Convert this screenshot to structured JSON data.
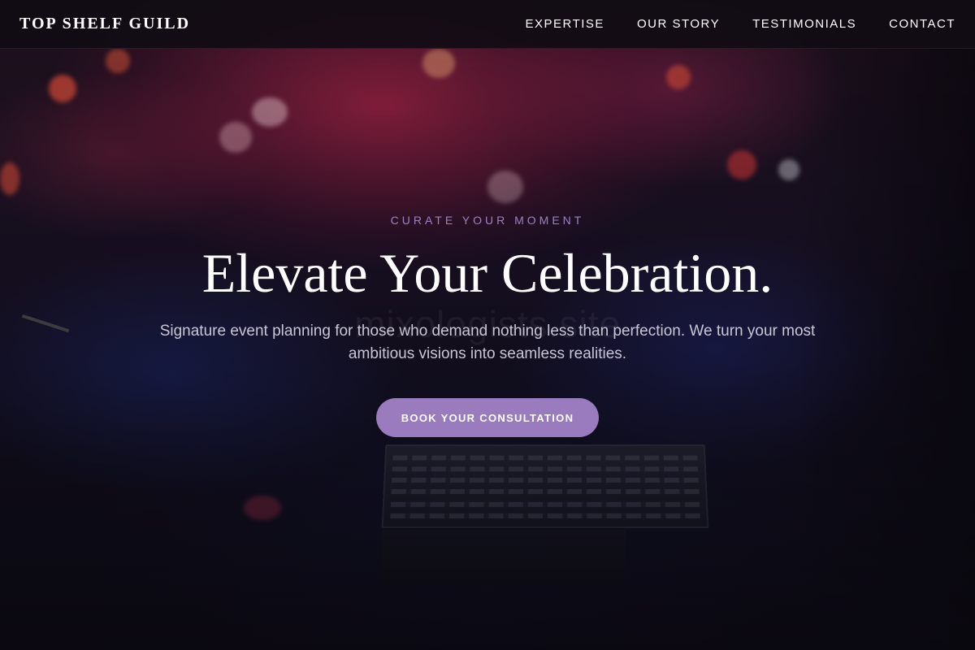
{
  "header": {
    "brand": "TOP SHELF GUILD",
    "nav": [
      {
        "label": "EXPERTISE"
      },
      {
        "label": "OUR STORY"
      },
      {
        "label": "TESTIMONIALS"
      },
      {
        "label": "CONTACT"
      }
    ]
  },
  "hero": {
    "eyebrow": "CURATE YOUR MOMENT",
    "headline": "Elevate Your Celebration.",
    "subtitle": "Signature event planning for those who demand nothing less than perfection. We turn your most ambitious visions into seamless realities.",
    "cta_label": "BOOK YOUR CONSULTATION",
    "watermark": "mixologists.site"
  },
  "colors": {
    "accent": "#9a7bbd",
    "eyebrow": "#9b82c4",
    "nav_bg": "#100c14"
  },
  "background_image": "concert-stage-image"
}
